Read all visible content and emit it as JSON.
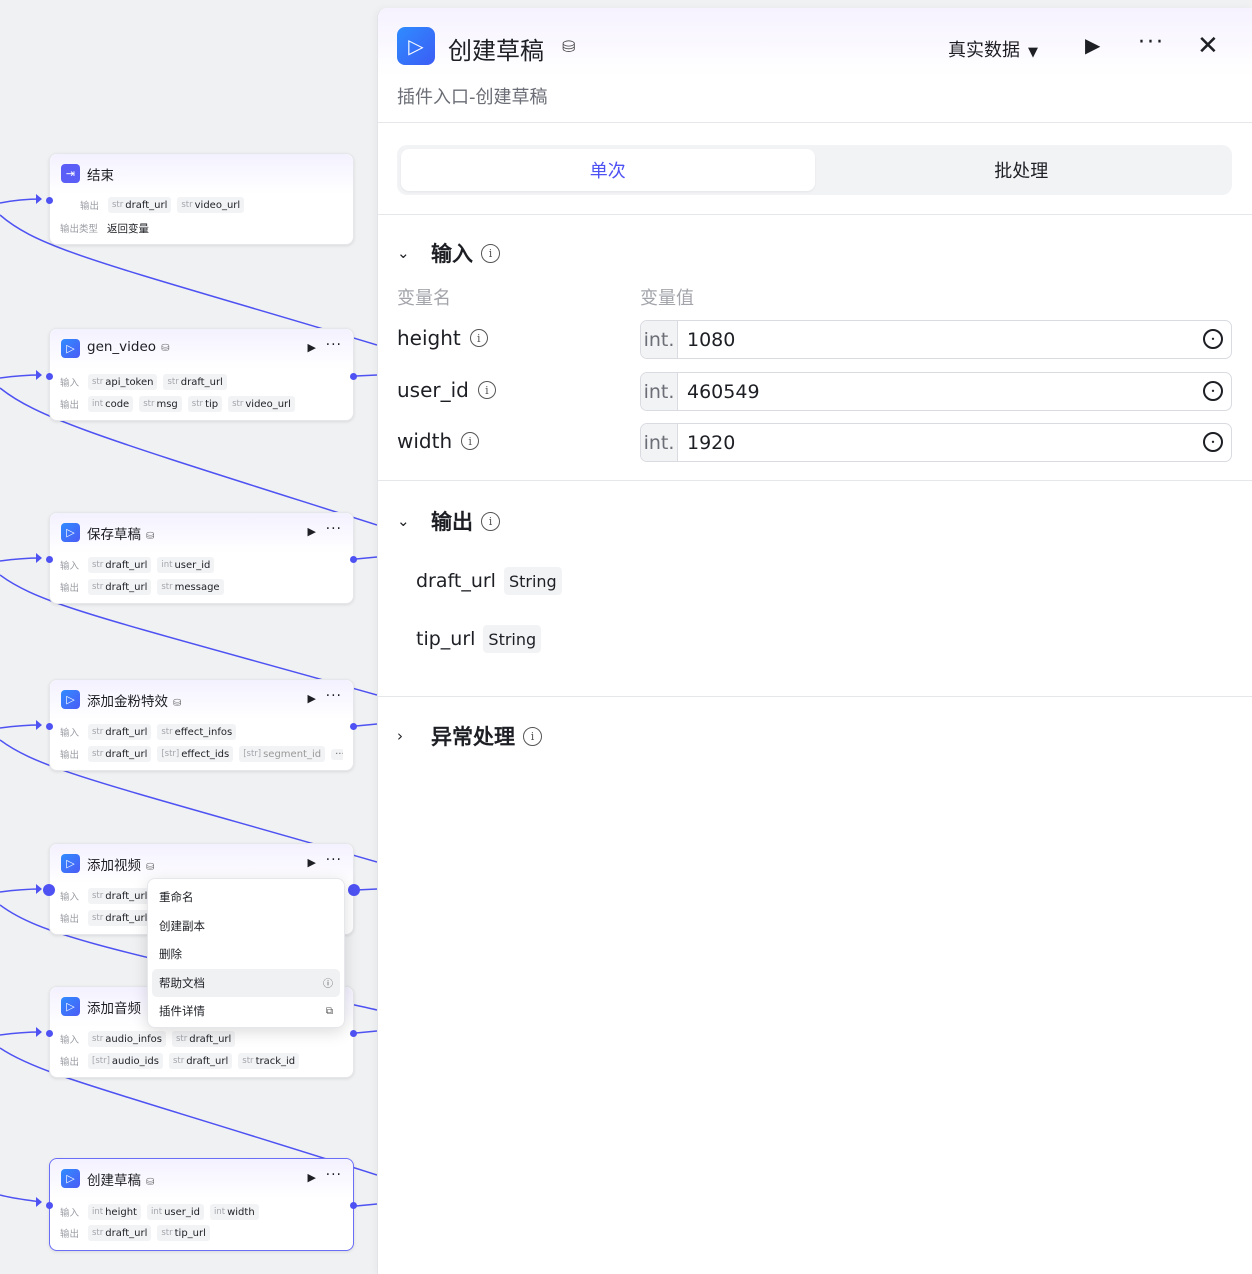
{
  "nodes": {
    "end": {
      "title": "结束",
      "output_label": "输出",
      "outputs": [
        {
          "t": "str",
          "n": "draft_url"
        },
        {
          "t": "str",
          "n": "video_url"
        }
      ],
      "output_type_label": "输出类型",
      "output_type_value": "返回变量"
    },
    "gen_video": {
      "title": "gen_video",
      "input_label": "输入",
      "inputs": [
        {
          "t": "str",
          "n": "api_token"
        },
        {
          "t": "str",
          "n": "draft_url"
        }
      ],
      "output_label": "输出",
      "outputs": [
        {
          "t": "int",
          "n": "code"
        },
        {
          "t": "str",
          "n": "msg"
        },
        {
          "t": "str",
          "n": "tip"
        },
        {
          "t": "str",
          "n": "video_url"
        }
      ]
    },
    "save_draft": {
      "title": "保存草稿",
      "input_label": "输入",
      "inputs": [
        {
          "t": "str",
          "n": "draft_url"
        },
        {
          "t": "int",
          "n": "user_id"
        }
      ],
      "output_label": "输出",
      "outputs": [
        {
          "t": "str",
          "n": "draft_url"
        },
        {
          "t": "str",
          "n": "message"
        }
      ]
    },
    "add_effect": {
      "title": "添加金粉特效",
      "input_label": "输入",
      "inputs": [
        {
          "t": "str",
          "n": "draft_url"
        },
        {
          "t": "str",
          "n": "effect_infos"
        }
      ],
      "output_label": "输出",
      "outputs": [
        {
          "t": "str",
          "n": "draft_url"
        },
        {
          "t": "[str]",
          "n": "effect_ids"
        },
        {
          "t": "[str]",
          "n": "segment_id"
        }
      ],
      "more": "···"
    },
    "add_video": {
      "title": "添加视频",
      "input_label": "输入",
      "inputs": [
        {
          "t": "str",
          "n": "draft_url"
        }
      ],
      "output_label": "输出",
      "outputs": [
        {
          "t": "str",
          "n": "draft_url"
        }
      ]
    },
    "add_audio": {
      "title": "添加音频",
      "input_label": "输入",
      "inputs": [
        {
          "t": "str",
          "n": "audio_infos"
        },
        {
          "t": "str",
          "n": "draft_url"
        }
      ],
      "output_label": "输出",
      "outputs": [
        {
          "t": "[str]",
          "n": "audio_ids"
        },
        {
          "t": "str",
          "n": "draft_url"
        },
        {
          "t": "str",
          "n": "track_id"
        }
      ]
    },
    "create_draft": {
      "title": "创建草稿",
      "input_label": "输入",
      "inputs": [
        {
          "t": "int",
          "n": "height"
        },
        {
          "t": "int",
          "n": "user_id"
        },
        {
          "t": "int",
          "n": "width"
        }
      ],
      "output_label": "输出",
      "outputs": [
        {
          "t": "str",
          "n": "draft_url"
        },
        {
          "t": "str",
          "n": "tip_url"
        }
      ]
    }
  },
  "context_menu": [
    "重命名",
    "创建副本",
    "删除",
    "帮助文档",
    "插件详情"
  ],
  "panel": {
    "title": "创建草稿",
    "description": "插件入口-创建草稿",
    "data_mode": "真实数据",
    "tabs": [
      "单次",
      "批处理"
    ],
    "active_tab": "单次",
    "input_section": "输入",
    "col_name": "变量名",
    "col_value": "变量值",
    "variables": [
      {
        "name": "height",
        "type": "int.",
        "value": "1080"
      },
      {
        "name": "user_id",
        "type": "int.",
        "value": "460549"
      },
      {
        "name": "width",
        "type": "int.",
        "value": "1920"
      }
    ],
    "output_section": "输出",
    "outputs": [
      {
        "name": "draft_url",
        "type": "String"
      },
      {
        "name": "tip_url",
        "type": "String"
      }
    ],
    "exception_section": "异常处理"
  },
  "colors": {
    "accent": "#4e52f2",
    "wire": "#4e52f2",
    "panel_bg": "#ffffff",
    "canvas_bg": "#f0f1f3"
  }
}
